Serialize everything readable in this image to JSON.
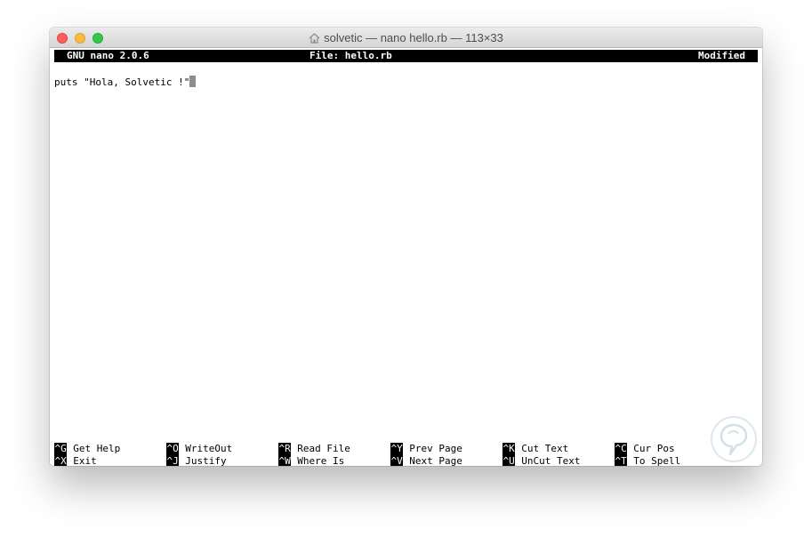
{
  "window": {
    "title": "solvetic — nano hello.rb — 113×33"
  },
  "nano": {
    "version_label": "GNU nano 2.0.6",
    "file_label": "File: hello.rb",
    "status_label": "Modified"
  },
  "editor": {
    "lines": [
      "puts \"Hola, Solvetic !\""
    ]
  },
  "shortcuts": {
    "row1": [
      {
        "key": "^G",
        "label": "Get Help"
      },
      {
        "key": "^O",
        "label": "WriteOut"
      },
      {
        "key": "^R",
        "label": "Read File"
      },
      {
        "key": "^Y",
        "label": "Prev Page"
      },
      {
        "key": "^K",
        "label": "Cut Text"
      },
      {
        "key": "^C",
        "label": "Cur Pos"
      }
    ],
    "row2": [
      {
        "key": "^X",
        "label": "Exit"
      },
      {
        "key": "^J",
        "label": "Justify"
      },
      {
        "key": "^W",
        "label": "Where Is"
      },
      {
        "key": "^V",
        "label": "Next Page"
      },
      {
        "key": "^U",
        "label": "UnCut Text"
      },
      {
        "key": "^T",
        "label": "To Spell"
      }
    ]
  },
  "colors": {
    "close": "#fc605c",
    "minimize": "#fdbc40",
    "maximize": "#34c84a",
    "status_bar": "#000000",
    "cursor": "#8c8c8c"
  },
  "icons": {
    "title": "home-icon",
    "watermark": "solvetic-logo"
  }
}
